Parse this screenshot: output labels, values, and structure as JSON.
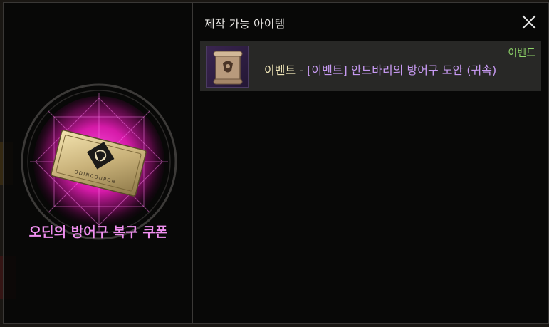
{
  "left_panel": {
    "coupon_name": "오딘의 방어구 복구 쿠폰",
    "coupon_card_text": "ODINCOUPON"
  },
  "right_panel": {
    "title": "제작 가능 아이템",
    "items": [
      {
        "category": "이벤트",
        "separator": " - ",
        "name": "[이벤트] 안드바리의 방어구 도안 (귀속)",
        "tag": "이벤트",
        "icon": "scroll-blueprint-icon"
      }
    ]
  },
  "colors": {
    "coupon_name": "#f08ff0",
    "item_category": "#f1e7b9",
    "item_name": "#c79af2",
    "tag": "#8fd66a",
    "emblem_glow": "#ff2fd0"
  },
  "icons": {
    "close": "close-icon",
    "coupon": "coupon-ticket-icon"
  }
}
